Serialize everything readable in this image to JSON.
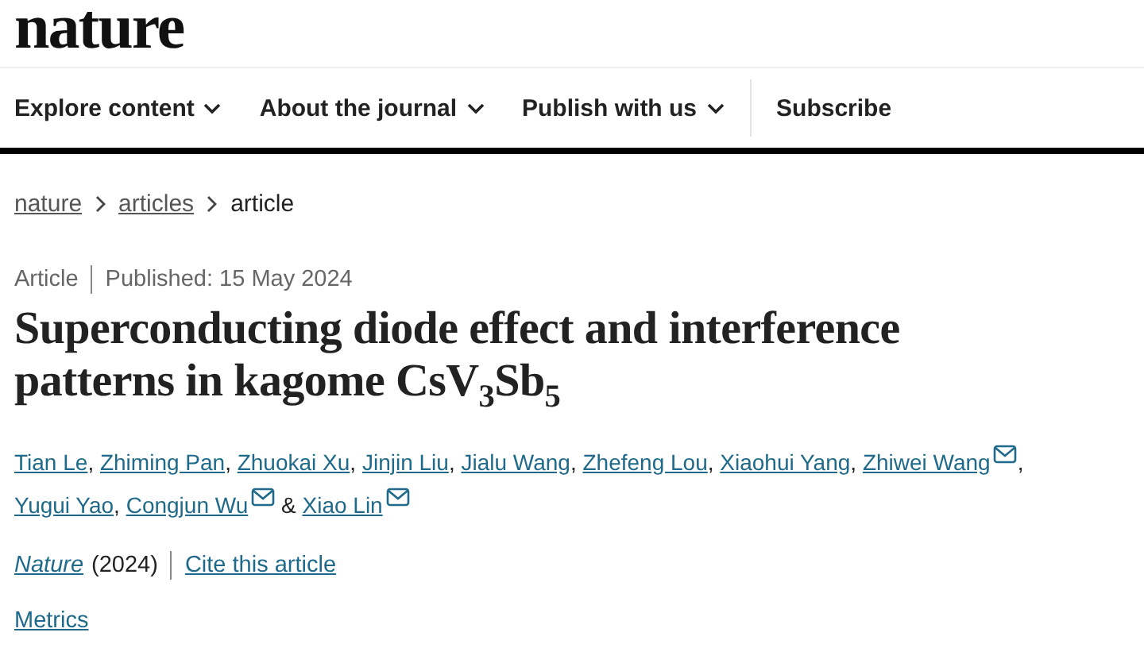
{
  "logo": "nature",
  "nav": [
    {
      "label": "Explore content",
      "dropdown": true
    },
    {
      "label": "About the journal",
      "dropdown": true
    },
    {
      "label": "Publish with us",
      "dropdown": true
    },
    {
      "label": "Subscribe",
      "dropdown": false
    }
  ],
  "breadcrumb": [
    {
      "label": "nature",
      "link": true
    },
    {
      "label": "articles",
      "link": true
    },
    {
      "label": "article",
      "link": false
    }
  ],
  "meta": {
    "type": "Article",
    "published": "Published: 15 May 2024"
  },
  "title": "Superconducting diode effect and interference patterns in kagome CsV$_{3}$Sb$_{5}$",
  "author_lines": [
    [
      {
        "name": "Tian Le",
        "email": false,
        "after": ","
      },
      {
        "name": "Zhiming Pan",
        "email": false,
        "after": ","
      },
      {
        "name": "Zhuokai Xu",
        "email": false,
        "after": ","
      },
      {
        "name": "Jinjin Liu",
        "email": false,
        "after": ","
      },
      {
        "name": "Jialu Wang",
        "email": false,
        "after": ","
      },
      {
        "name": "Zhefeng Lou",
        "email": false,
        "after": ","
      },
      {
        "name": "Xiaohui Yang",
        "email": false,
        "after": ","
      },
      {
        "name": "Zhiwei Wang",
        "email": true,
        "after": ","
      }
    ],
    [
      {
        "name": "Yugui Yao",
        "email": false,
        "after": ","
      },
      {
        "name": "Congjun Wu",
        "email": true,
        "after": "&"
      },
      {
        "name": "Xiao Lin",
        "email": true
      }
    ]
  ],
  "citation": {
    "journal": "Nature",
    "year": "(2024)",
    "cite": "Cite this article"
  },
  "metrics": "Metrics"
}
